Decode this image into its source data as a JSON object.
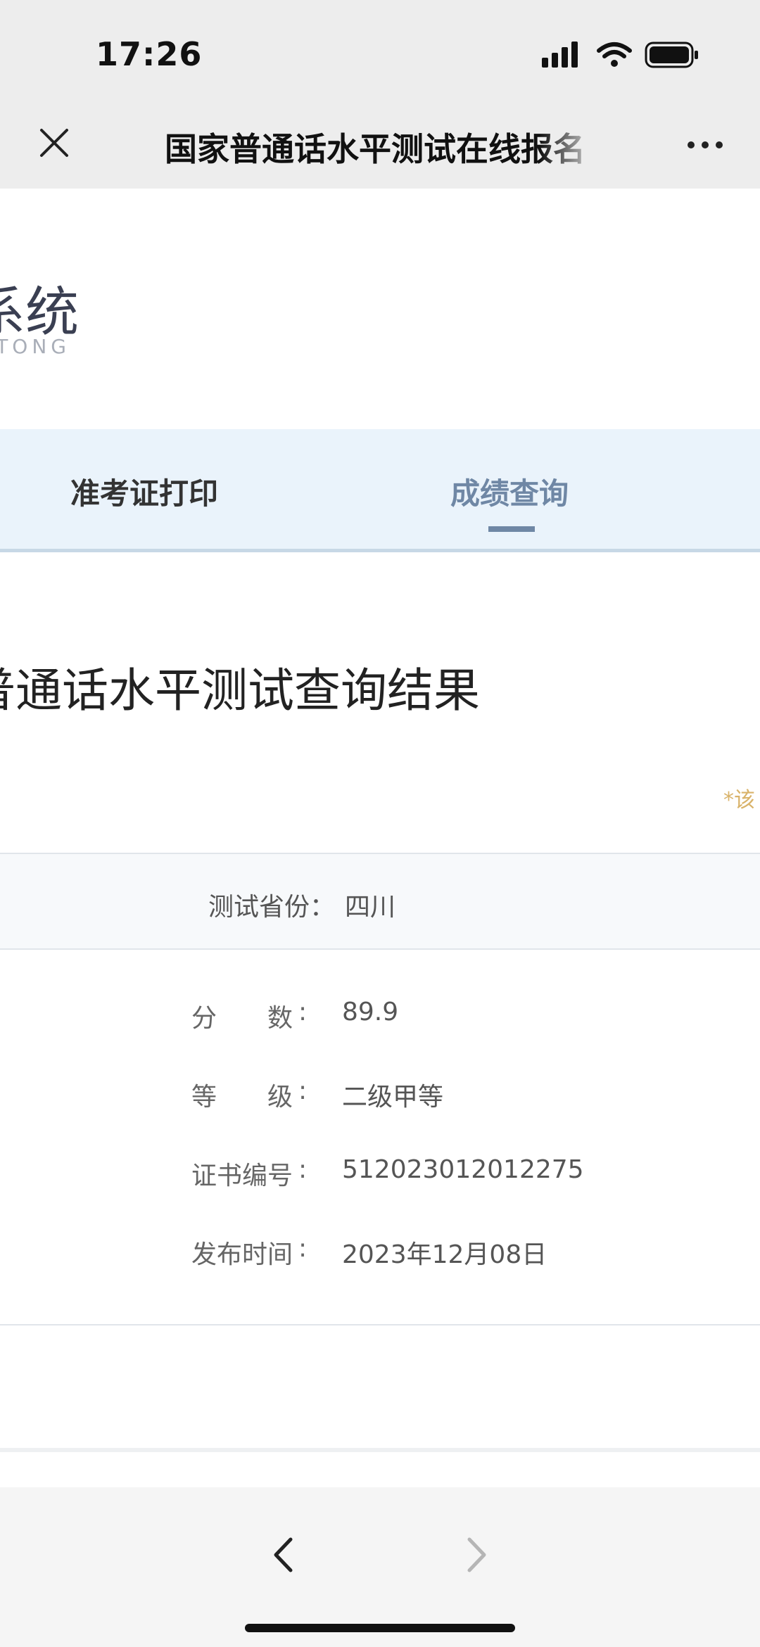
{
  "status_bar": {
    "time": "17:26",
    "icons": [
      "signal-icon",
      "wifi-icon",
      "battery-icon"
    ]
  },
  "nav": {
    "title": "国家普通话水平测试在线报名",
    "close_icon": "close-icon",
    "more_icon": "more-icon"
  },
  "logo": {
    "cn_fragment": "系统",
    "en_fragment": "TONG"
  },
  "tabs": [
    {
      "label": "准考证打印",
      "active": false
    },
    {
      "label": "成绩查询",
      "active": true
    }
  ],
  "result": {
    "title": "普通话水平测试查询结果",
    "note": "*该",
    "province_label": "测试省份：",
    "province_value": "四川",
    "rows": [
      {
        "label": "分数",
        "value": "89.9"
      },
      {
        "label": "等级",
        "value": "二级甲等"
      },
      {
        "label": "证书编号",
        "value": "512023012012275"
      },
      {
        "label": "发布时间",
        "value": "2023年12月08日"
      }
    ]
  },
  "bottom_bar": {
    "back_icon": "chevron-left-icon",
    "forward_icon": "chevron-right-icon"
  },
  "colors": {
    "accent": "#6f87a5",
    "tab_band": "#eaf3fb",
    "note": "#d9b36a"
  }
}
